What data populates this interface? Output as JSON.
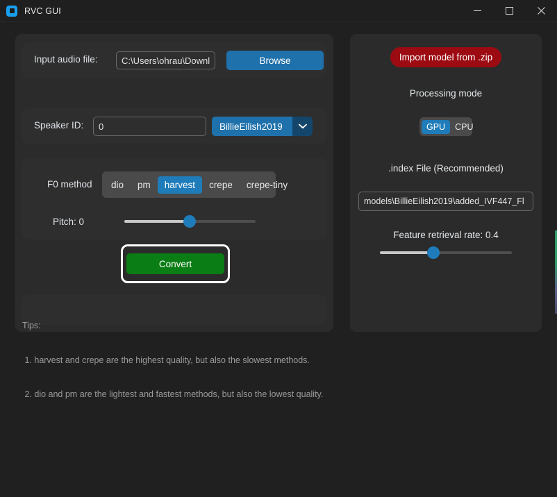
{
  "window": {
    "title": "RVC GUI",
    "icon": "app-logo-icon",
    "minimize_label": "—",
    "maximize_label": "□",
    "close_label": "✕"
  },
  "left_panel": {
    "input_file": {
      "label": "Input audio file:",
      "value": "C:\\Users\\ohrau\\Downl",
      "placeholder": "",
      "browse_label": "Browse"
    },
    "speaker": {
      "label": "Speaker ID:",
      "value": "0",
      "placeholder": "",
      "selected_model": "BillieEilish2019",
      "arrow_icon": "chevron-down-icon"
    },
    "f0": {
      "label": "F0 method",
      "options": [
        "dio",
        "pm",
        "harvest",
        "crepe",
        "crepe-tiny"
      ],
      "selected": "harvest"
    },
    "pitch": {
      "label": "Pitch: 0",
      "value": 0,
      "min": -12,
      "max": 12,
      "fill_percent": 50
    },
    "convert": {
      "label": "Convert",
      "focused": true
    },
    "tips": {
      "heading": "Tips:",
      "lines": [
        " 1. harvest and crepe are the highest quality, but also the slowest methods.",
        " 2. dio and pm are the lightest and fastest methods, but also the lowest quality."
      ]
    }
  },
  "right_panel": {
    "import_label": "Import model from .zip",
    "processing_mode": {
      "label": "Processing mode",
      "options": [
        "GPU",
        "CPU"
      ],
      "selected": "GPU"
    },
    "index_file": {
      "label": ".index File (Recommended)",
      "value": "models\\BillieEilish2019\\added_IVF447_Fl",
      "placeholder": ""
    },
    "feature_rate": {
      "label": "Feature retrieval rate: 0.4",
      "value": 0.4,
      "min": 0,
      "max": 1,
      "fill_percent": 40
    }
  },
  "colors": {
    "accent_blue": "#1f7cba",
    "import_red": "#9c0b12",
    "convert_green": "#0a7d14",
    "window_bg": "#202020",
    "panel_bg": "#2b2b2b",
    "card_bg": "#2e2e2e"
  }
}
